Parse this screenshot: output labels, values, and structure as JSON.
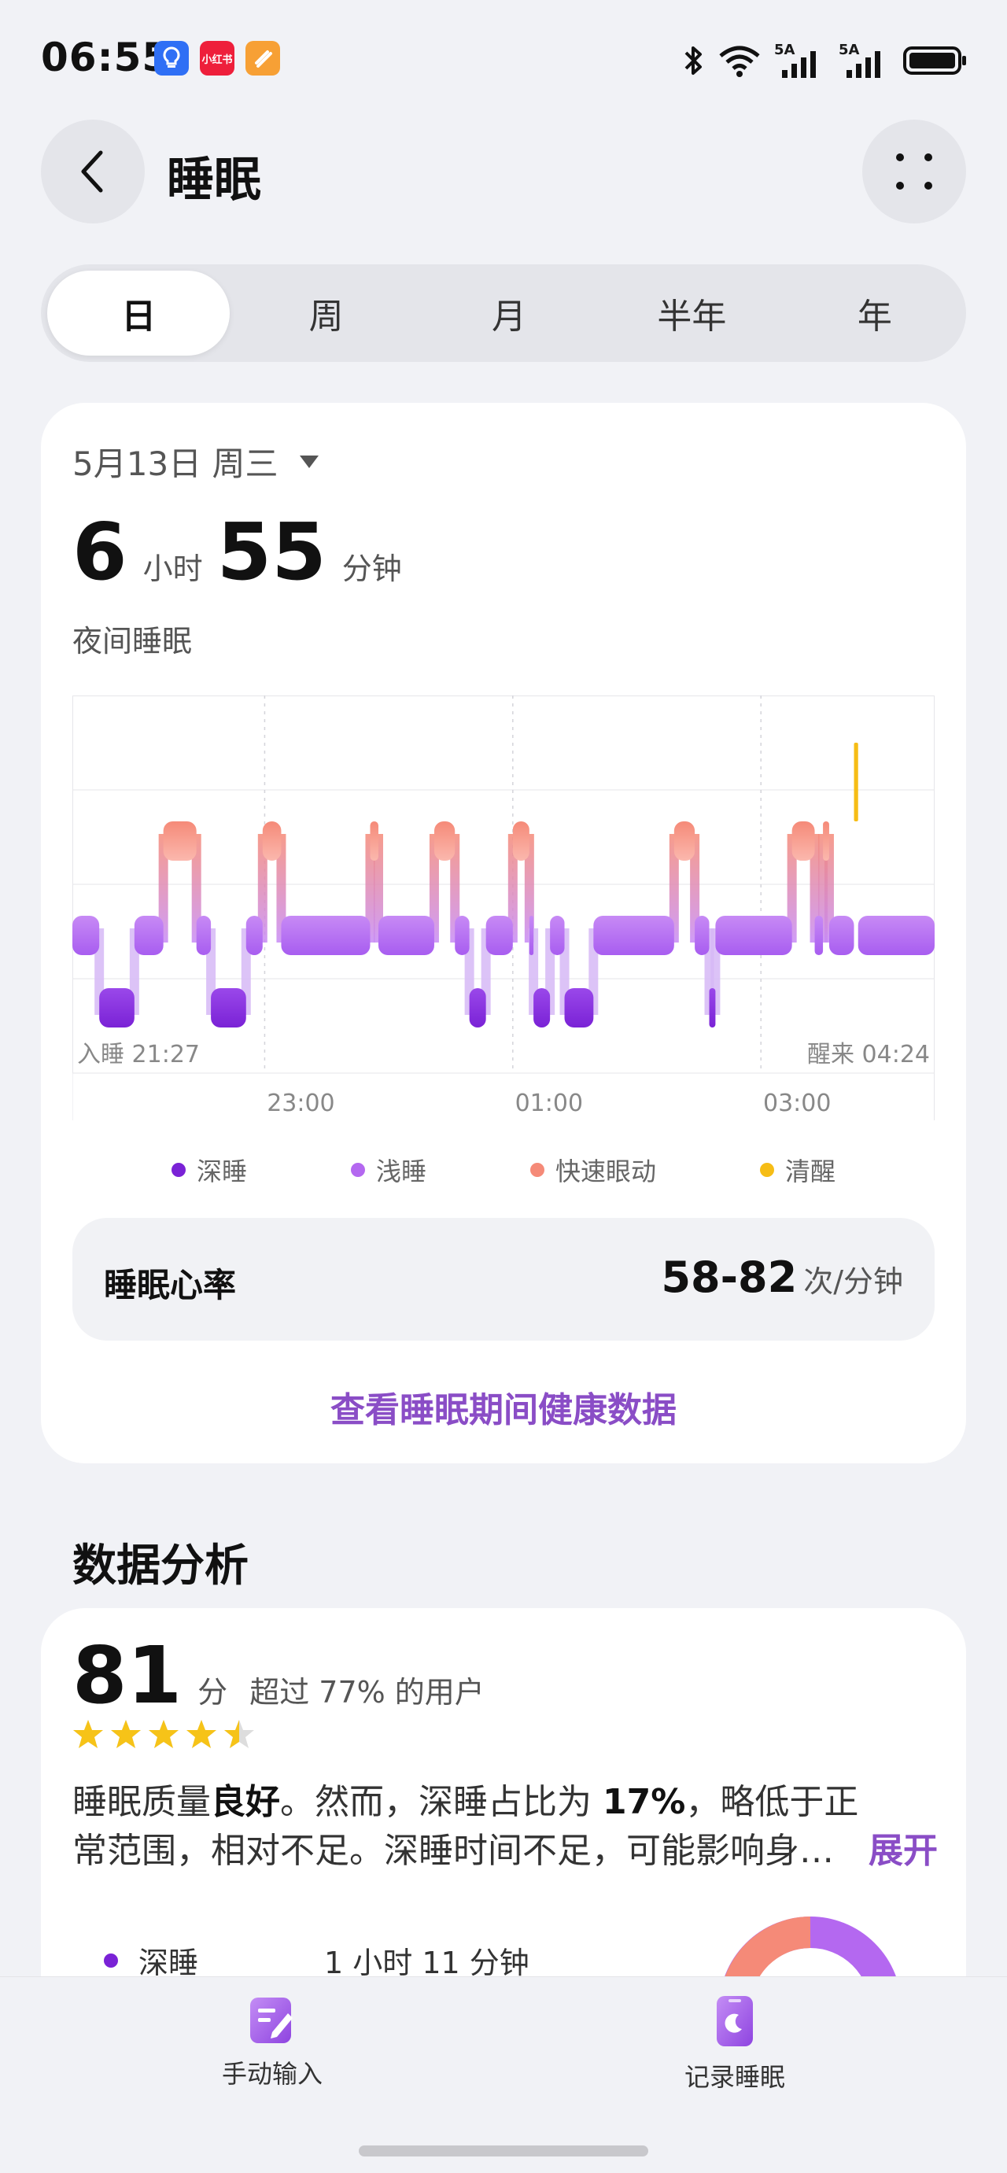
{
  "status": {
    "time": "06:55",
    "app_icons": [
      {
        "name": "lightbulb-app-icon",
        "color": "#2f6ff5",
        "text": ""
      },
      {
        "name": "xiaohongshu-app-icon",
        "color": "#ee1f3b",
        "text": "小红书"
      },
      {
        "name": "orange-app-icon",
        "color": "#f7a035",
        "text": ""
      }
    ],
    "net_labels": [
      "5A",
      "5A"
    ]
  },
  "header": {
    "title": "睡眠"
  },
  "tabs": [
    "日",
    "周",
    "月",
    "半年",
    "年"
  ],
  "summary": {
    "date": "5月13日 周三",
    "hours": "6",
    "hours_unit": "小时",
    "minutes": "55",
    "minutes_unit": "分钟",
    "label": "夜间睡眠"
  },
  "chart_data": {
    "type": "area",
    "sleep_start_label": "入睡 21:27",
    "wake_label": "醒来 04:24",
    "x_ticks": [
      "23:00",
      "01:00",
      "03:00"
    ],
    "legend": [
      {
        "name": "深睡",
        "color": "#7a22d6"
      },
      {
        "name": "浅睡",
        "color": "#b468f0"
      },
      {
        "name": "快速眼动",
        "color": "#f58a78"
      },
      {
        "name": "清醒",
        "color": "#f6bd16"
      }
    ],
    "stages": [
      [
        "21:27",
        "21:40",
        "浅睡"
      ],
      [
        "21:40",
        "21:57",
        "深睡"
      ],
      [
        "21:57",
        "22:11",
        "浅睡"
      ],
      [
        "22:11",
        "22:27",
        "快速眼动"
      ],
      [
        "22:27",
        "22:34",
        "浅睡"
      ],
      [
        "22:34",
        "22:51",
        "深睡"
      ],
      [
        "22:51",
        "22:59",
        "浅睡"
      ],
      [
        "22:59",
        "23:08",
        "快速眼动"
      ],
      [
        "23:08",
        "23:51",
        "浅睡"
      ],
      [
        "23:51",
        "23:55",
        "快速眼动"
      ],
      [
        "23:55",
        "00:22",
        "浅睡"
      ],
      [
        "00:22",
        "00:32",
        "快速眼动"
      ],
      [
        "00:32",
        "00:39",
        "浅睡"
      ],
      [
        "00:39",
        "00:47",
        "深睡"
      ],
      [
        "00:47",
        "01:00",
        "浅睡"
      ],
      [
        "01:00",
        "01:08",
        "快速眼动"
      ],
      [
        "01:08",
        "01:10",
        "浅睡"
      ],
      [
        "01:10",
        "01:18",
        "深睡"
      ],
      [
        "01:18",
        "01:25",
        "浅睡"
      ],
      [
        "01:25",
        "01:39",
        "深睡"
      ],
      [
        "01:39",
        "02:18",
        "浅睡"
      ],
      [
        "02:18",
        "02:28",
        "快速眼动"
      ],
      [
        "02:28",
        "02:35",
        "浅睡"
      ],
      [
        "02:35",
        "02:38",
        "深睡"
      ],
      [
        "02:38",
        "03:15",
        "浅睡"
      ],
      [
        "03:15",
        "03:26",
        "快速眼动"
      ],
      [
        "03:26",
        "03:30",
        "浅睡"
      ],
      [
        "03:30",
        "03:33",
        "快速眼动"
      ],
      [
        "03:33",
        "03:45",
        "浅睡"
      ],
      [
        "03:45",
        "03:47",
        "清醒"
      ],
      [
        "03:47",
        "04:24",
        "浅睡"
      ]
    ]
  },
  "heart_rate": {
    "label": "睡眠心率",
    "value": "58-82",
    "unit": "次/分钟"
  },
  "link_text": "查看睡眠期间健康数据",
  "analysis": {
    "title": "数据分析",
    "score": "81",
    "score_unit": "分",
    "compare": "超过 77% 的用户",
    "stars": 4.5,
    "desc_1": "睡眠质量",
    "desc_bold_1": "良好",
    "desc_2": "。然而，深睡占比为 ",
    "desc_bold_2": "17%",
    "desc_3": "，略低于正常范围，相对不足。深睡时间不足，可能影响身…",
    "expand": "展开",
    "stage_label": "深睡",
    "stage_value": "1 小时 11 分钟"
  },
  "bottom": {
    "manual_input": "手动输入",
    "record_sleep": "记录睡眠"
  }
}
